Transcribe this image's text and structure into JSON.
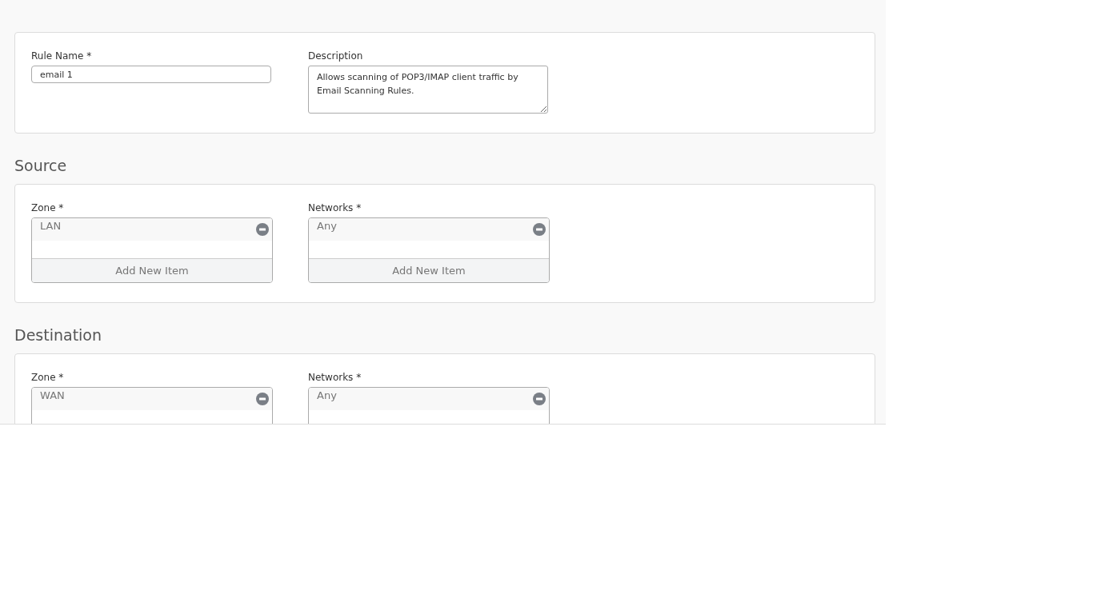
{
  "general": {
    "rule_name": {
      "label": "Rule Name *",
      "value": "email 1"
    },
    "description": {
      "label": "Description",
      "value": "Allows scanning of POP3/IMAP client traffic by Email Scanning Rules."
    }
  },
  "sections": [
    {
      "title": "Source",
      "fields": [
        {
          "label": "Zone *",
          "items": [
            "LAN"
          ],
          "add_button": "Add New Item"
        },
        {
          "label": "Networks *",
          "items": [
            "Any"
          ],
          "add_button": "Add New Item"
        }
      ]
    },
    {
      "title": "Destination",
      "fields": [
        {
          "label": "Zone *",
          "items": [
            "WAN"
          ]
        },
        {
          "label": "Networks *",
          "items": [
            "Any"
          ]
        }
      ]
    }
  ]
}
